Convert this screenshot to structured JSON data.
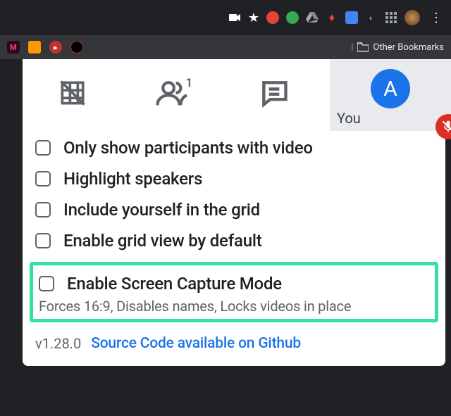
{
  "browser": {
    "star_icon": "★",
    "other_bookmarks_label": "Other Bookmarks"
  },
  "self_view": {
    "label": "You",
    "avatar_letter": "A"
  },
  "tabs": {
    "people_badge": "1"
  },
  "options": [
    {
      "label": "Only show participants with video"
    },
    {
      "label": "Highlight speakers"
    },
    {
      "label": "Include yourself in the grid"
    },
    {
      "label": "Enable grid view by default"
    }
  ],
  "highlight": {
    "label": "Enable Screen Capture Mode",
    "desc": "Forces 16:9, Disables names, Locks videos in place"
  },
  "footer": {
    "version": "v1.28.0",
    "source_link": "Source Code available on Github"
  }
}
